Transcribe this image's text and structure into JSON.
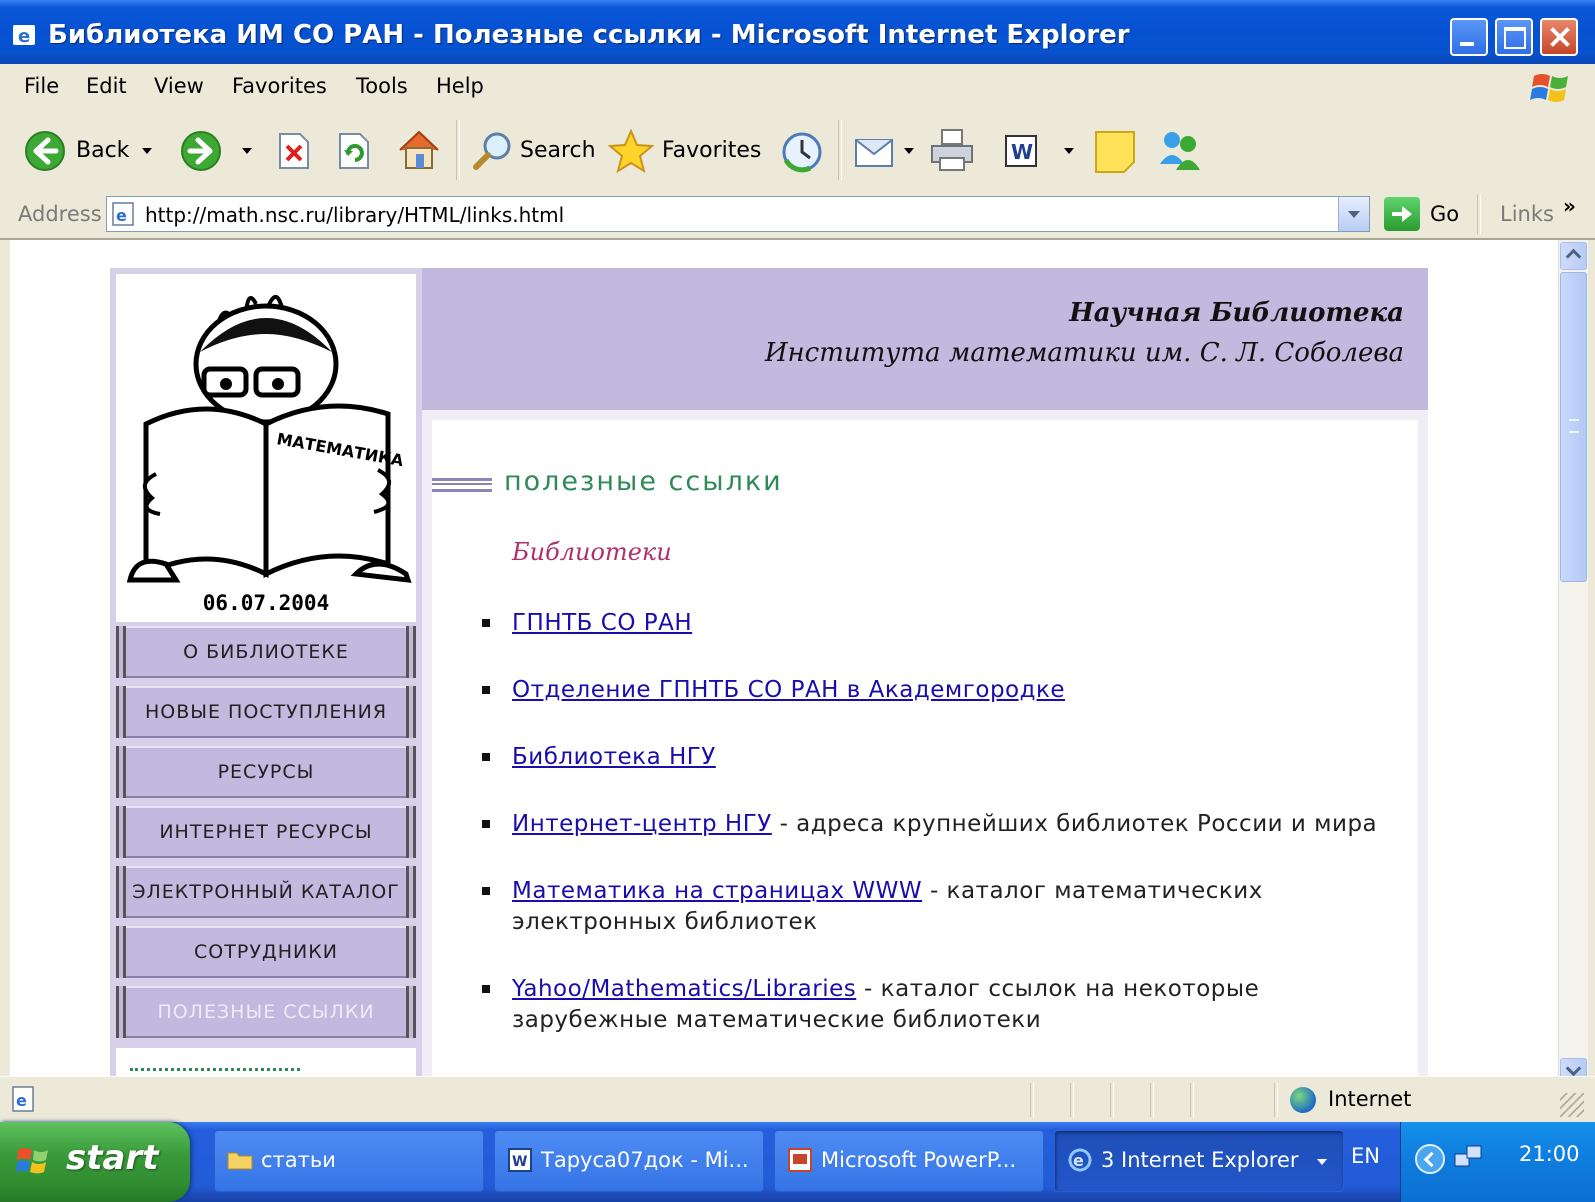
{
  "window": {
    "title": "Библиотека ИМ СО РАН - Полезные ссылки - Microsoft Internet Explorer"
  },
  "menu": [
    "File",
    "Edit",
    "View",
    "Favorites",
    "Tools",
    "Help"
  ],
  "toolbar": {
    "back_label": "Back",
    "search_label": "Search",
    "favorites_label": "Favorites"
  },
  "address": {
    "label": "Address",
    "url": "http://math.nsc.ru/library/HTML/links.html",
    "go_label": "Go",
    "links_label": "Links",
    "links_more": "»"
  },
  "page": {
    "date": "06.07.2004",
    "library_title_line1": "Научная Библиотека",
    "library_title_line2": "Института математики им. С. Л. Соболева",
    "nav": [
      {
        "label": "О БИБЛИОТЕКЕ",
        "active": false
      },
      {
        "label": "НОВЫЕ ПОСТУПЛЕНИЯ",
        "active": false
      },
      {
        "label": "РЕСУРСЫ",
        "active": false
      },
      {
        "label": "ИНТЕРНЕТ РЕСУРСЫ",
        "active": false
      },
      {
        "label": "ЭЛЕКТРОННЫЙ КАТАЛОГ",
        "active": false
      },
      {
        "label": "СОТРУДНИКИ",
        "active": false
      },
      {
        "label": "ПОЛЕЗНЫЕ ССЫЛКИ",
        "active": true
      }
    ],
    "section_title": "полезные ссылки",
    "subheading": "Библиотеки",
    "links": [
      {
        "text": "ГПНТБ СО РАН",
        "desc": ""
      },
      {
        "text": "Отделение ГПНТБ СО РАН в Академгородке",
        "desc": ""
      },
      {
        "text": "Библиотека НГУ",
        "desc": ""
      },
      {
        "text": "Интернет-центр НГУ",
        "desc": " - адреса крупнейших библиотек России и мира"
      },
      {
        "text": "Математика на страницах WWW",
        "desc": " - каталог математических электронных библиотек"
      },
      {
        "text": "Yahoo/Mathematics/Libraries",
        "desc": " - каталог ссылок на некоторые зарубежные математические библиотеки"
      }
    ]
  },
  "status": {
    "zone_label": "Internet"
  },
  "taskbar": {
    "start_label": "start",
    "tasks": [
      {
        "label": "статьи",
        "icon": "folder-icon"
      },
      {
        "label": "Таруса07док - Mi...",
        "icon": "word-icon"
      },
      {
        "label": "Microsoft PowerP...",
        "icon": "powerpoint-icon"
      },
      {
        "label": "3 Internet Explorer",
        "icon": "ie-icon"
      }
    ],
    "language": "EN",
    "clock": "21:00"
  }
}
